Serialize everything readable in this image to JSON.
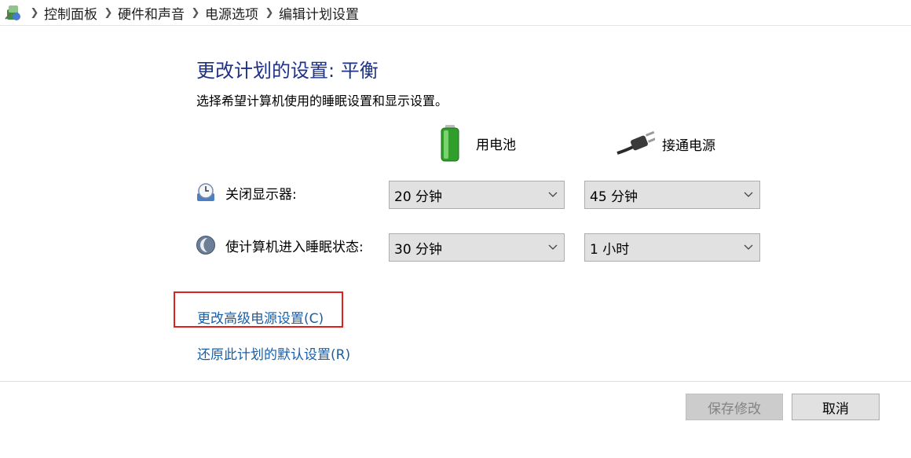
{
  "breadcrumb": {
    "root_icon": "control-panel-icon",
    "items": [
      "控制面板",
      "硬件和声音",
      "电源选项",
      "编辑计划设置"
    ]
  },
  "header": {
    "title": "更改计划的设置: 平衡",
    "subtitle": "选择希望计算机使用的睡眠设置和显示设置。"
  },
  "columns": {
    "battery": {
      "label": "用电池",
      "icon": "battery-icon"
    },
    "plugged_in": {
      "label": "接通电源",
      "icon": "power-plug-icon"
    }
  },
  "settings": {
    "display_off": {
      "label": "关闭显示器:",
      "icon": "display-clock-icon",
      "battery_value": "20 分钟",
      "plugged_value": "45 分钟"
    },
    "sleep": {
      "label": "使计算机进入睡眠状态:",
      "icon": "moon-sleep-icon",
      "battery_value": "30 分钟",
      "plugged_value": "1 小时"
    }
  },
  "links": {
    "advanced": "更改高级电源设置(C)",
    "restore": "还原此计划的默认设置(R)"
  },
  "buttons": {
    "save": "保存修改",
    "cancel": "取消"
  },
  "colors": {
    "title": "#1e3287",
    "link": "#1a5fa6",
    "highlight": "#e0201c"
  }
}
